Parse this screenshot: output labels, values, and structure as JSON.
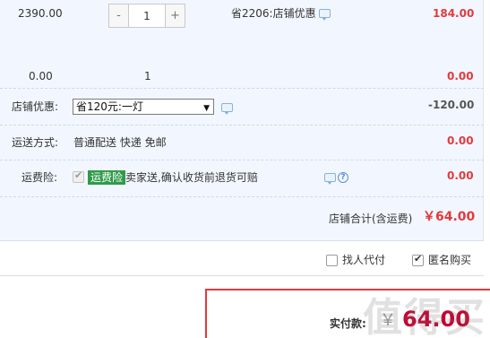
{
  "item": {
    "unit_price": "2390.00",
    "quantity": "1",
    "minus_label": "-",
    "plus_label": "+",
    "discount_text": "省2206:店铺优惠",
    "subtotal": "184.00"
  },
  "summary_row": {
    "price": "0.00",
    "quantity": "1",
    "subtotal": "0.00"
  },
  "shop_discount": {
    "label": "店铺优惠:",
    "selected_option": "省120元:一灯",
    "amount": "-120.00"
  },
  "shipping": {
    "label": "运送方式:",
    "method": "普通配送 快递 免邮",
    "amount": "0.00"
  },
  "freight_insurance": {
    "label": "运费险:",
    "badge": "运费险",
    "description": "卖家送,确认收货前退货可赔",
    "amount": "0.00"
  },
  "shop_total": {
    "label": "店铺合计(含运费)",
    "amount": "￥64.00"
  },
  "options": {
    "pay_for_me": "找人代付",
    "anonymous": "匿名购买"
  },
  "payment": {
    "label": "实付款:",
    "currency": "￥",
    "amount": "64.00"
  },
  "watermark": "值得买",
  "colors": {
    "accent_red": "#e4393c",
    "panel_bg": "#f2f7ff",
    "badge_green": "#2e9b4a"
  }
}
